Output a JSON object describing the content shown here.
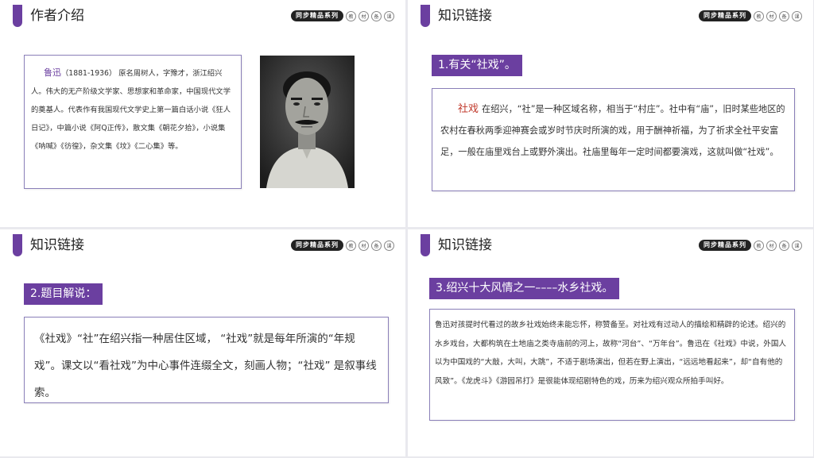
{
  "brand": {
    "series_label": "同步精品系列",
    "seals": [
      "教",
      "材",
      "备",
      "课"
    ]
  },
  "slides": [
    {
      "title": "作者介绍",
      "author_name": "鲁迅",
      "author_bio": "（1881-1936） 原名周树人，字豫才，浙江绍兴人。伟大的无产阶级文学家、思想家和革命家，中国现代文学的奠基人。代表作有我国现代文学史上第一篇白话小说《狂人日记》，中篇小说《阿Q正传》，散文集《朝花夕拾》，小说集《呐喊》《彷徨》，杂文集《坟》《二心集》等。",
      "photo_desc": "author-portrait"
    },
    {
      "title": "知识链接",
      "heading": "1.有关“社戏”。",
      "keyword": "社戏",
      "body": "在绍兴，“社”是一种区域名称，相当于“村庄”。社中有“庙”，旧时某些地区的农村在春秋两季迎神赛会或岁时节庆时所演的戏，用于酬神祈福，为了祈求全社平安富足，一般在庙里戏台上或野外演出。社庙里每年一定时间都要演戏，这就叫做“社戏”。"
    },
    {
      "title": "知识链接",
      "heading": "2.题目解说：",
      "body": "《社戏》“社”在绍兴指一种居住区域， “社戏”就是每年所演的“年规戏”。课文以“看社戏”为中心事件连缀全文，刻画人物；“社戏” 是叙事线索。"
    },
    {
      "title": "知识链接",
      "heading": "3.绍兴十大风情之一––––水乡社戏。",
      "body": "鲁迅对孩提时代看过的故乡社戏始终未能忘怀，称赞备至。对社戏有过动人的描绘和精辟的论述。绍兴的水乡戏台，大都构筑在土地庙之类寺庙前的河上，故称“河台”、“万年台”。鲁迅在《社戏》中说，外国人以为中国戏的“大敲，大叫，大跳”，不适于剧场演出，但若在野上演出，“远远地看起来”，却“自有他的风致”。《龙虎斗》《游园吊打》是很能体现绍剧特色的戏，历来为绍兴观众所拍手叫好。"
    }
  ],
  "colors": {
    "accent": "#6b3fa0",
    "keyword_red": "#c0392b",
    "box_border": "#8a7fb8"
  }
}
